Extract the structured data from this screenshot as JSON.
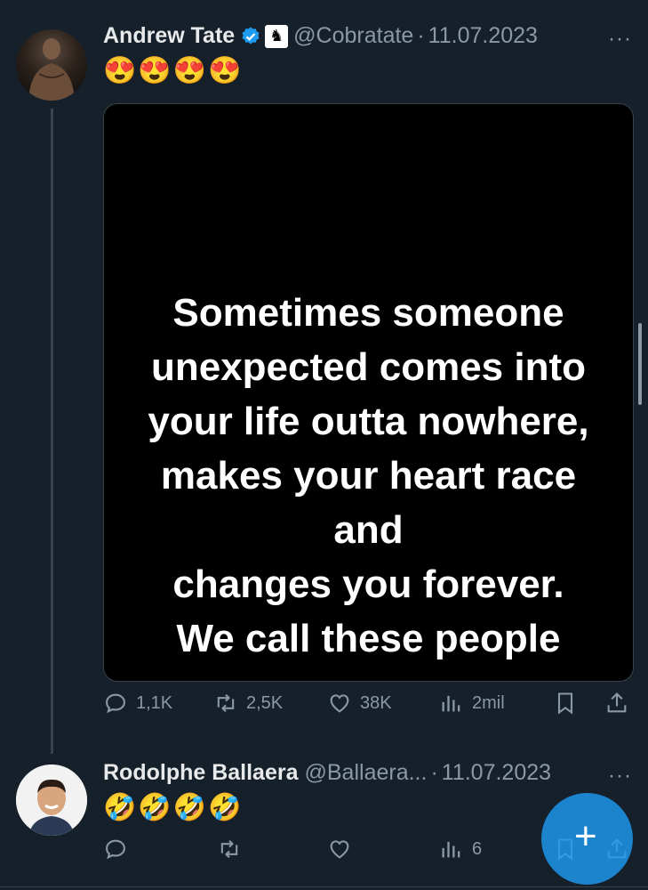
{
  "tweet1": {
    "name": "Andrew Tate",
    "handle": "@Cobratate",
    "separator": "·",
    "date": "11.07.2023",
    "emojis": "😍😍😍😍",
    "image_text": "Sometimes someone\nunexpected comes into\nyour life outta nowhere,\nmakes your heart race\nand\nchanges you forever.\nWe call these people\ncops.",
    "actions": {
      "replies": "1,1K",
      "retweets": "2,5K",
      "likes": "38K",
      "views": "2mil"
    }
  },
  "tweet2": {
    "name": "Rodolphe Ballaera",
    "handle": "@Ballaera...",
    "separator": "·",
    "date": "11.07.2023",
    "emojis": "🤣🤣🤣🤣",
    "actions": {
      "views": "6"
    }
  },
  "more_label": "···",
  "fab_label": "+",
  "colors": {
    "background": "#15202b",
    "text": "#e7e9ea",
    "secondary": "#8b98a5",
    "accent": "#1d9bf0",
    "border": "#38444d"
  },
  "icons": [
    "verified-badge-icon",
    "affiliate-knight-icon",
    "reply-icon",
    "retweet-icon",
    "like-icon",
    "views-icon",
    "bookmark-icon",
    "share-icon",
    "more-icon",
    "compose-plus-icon"
  ]
}
